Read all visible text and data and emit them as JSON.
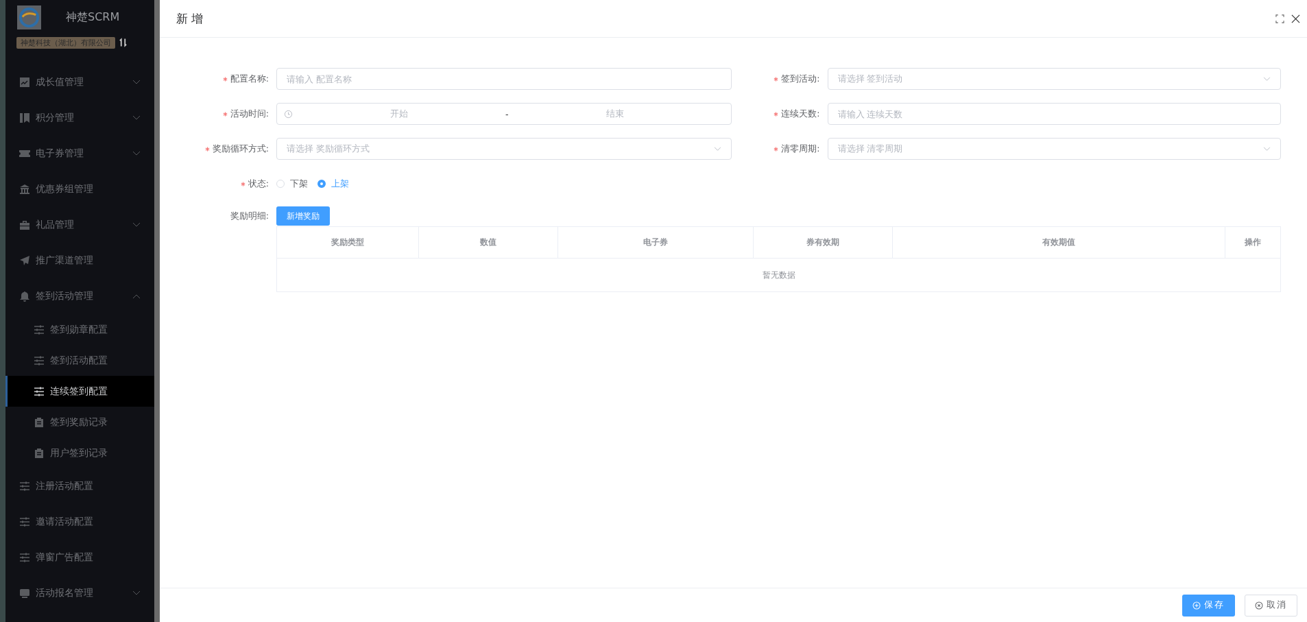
{
  "sidebar": {
    "brand": "神楚SCRM",
    "company": "神楚科技（湖北）有限公司",
    "items": [
      {
        "label": "成长值管理",
        "expanded": false,
        "selected": false
      },
      {
        "label": "积分管理",
        "expanded": false,
        "selected": false
      },
      {
        "label": "电子券管理",
        "expanded": false,
        "selected": false
      },
      {
        "label": "优惠券组管理",
        "selected": false
      },
      {
        "label": "礼品管理",
        "expanded": false,
        "selected": false
      },
      {
        "label": "推广渠道管理",
        "selected": false
      },
      {
        "label": "签到活动管理",
        "expanded": true,
        "selected": false,
        "children": [
          {
            "label": "签到勋章配置",
            "selected": false
          },
          {
            "label": "签到活动配置",
            "selected": false
          },
          {
            "label": "连续签到配置",
            "selected": true
          },
          {
            "label": "签到奖励记录",
            "selected": false
          },
          {
            "label": "用户签到记录",
            "selected": false
          }
        ]
      },
      {
        "label": "注册活动配置",
        "selected": false
      },
      {
        "label": "邀请活动配置",
        "selected": false
      },
      {
        "label": "弹窗广告配置",
        "selected": false
      },
      {
        "label": "活动报名管理",
        "expanded": false,
        "selected": false
      }
    ]
  },
  "dialog": {
    "title": "新 增",
    "fields": [
      {
        "label": "配置名称:",
        "required": true,
        "kind": "text",
        "placeholder": "请输入 配置名称"
      },
      {
        "label": "签到活动:",
        "required": true,
        "kind": "select",
        "placeholder": "请选择 签到活动"
      },
      {
        "label": "活动时间:",
        "required": true,
        "kind": "date-range",
        "start_placeholder": "开始",
        "separator": "-",
        "end_placeholder": "结束"
      },
      {
        "label": "连续天数:",
        "required": true,
        "kind": "text",
        "placeholder": "请输入 连续天数"
      },
      {
        "label": "奖励循环方式:",
        "required": true,
        "kind": "select",
        "placeholder": "请选择 奖励循环方式"
      },
      {
        "label": "清零周期:",
        "required": true,
        "kind": "select",
        "placeholder": "请选择 清零周期"
      }
    ],
    "status": {
      "label": "状态:",
      "required": true,
      "options": [
        {
          "label": "下架",
          "selected": false
        },
        {
          "label": "上架",
          "selected": true
        }
      ]
    },
    "rewards": {
      "label": "奖励明细:",
      "add_button": "新增奖励",
      "table": {
        "columns": [
          "奖励类型",
          "数值",
          "电子券",
          "券有效期",
          "有效期值",
          "操作"
        ],
        "empty_text": "暂无数据"
      }
    },
    "buttons": [
      {
        "label": "保存",
        "kind": "primary"
      },
      {
        "label": "取消",
        "kind": "default"
      }
    ]
  }
}
